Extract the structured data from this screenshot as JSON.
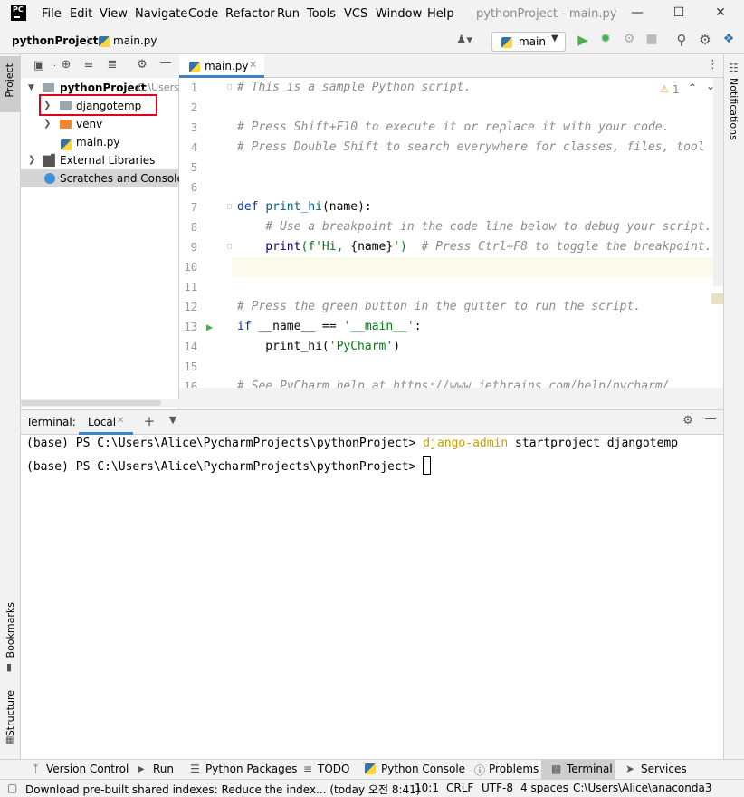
{
  "titlebar": {
    "logo": "PC",
    "menu": [
      "File",
      "Edit",
      "View",
      "Navigate",
      "Code",
      "Refactor",
      "Run",
      "Tools",
      "VCS",
      "Window",
      "Help"
    ],
    "window_title": "pythonProject - main.py"
  },
  "navbar": {
    "project": "pythonProject",
    "file": "main.py",
    "run_config": "main"
  },
  "left_stripe": {
    "project": "Project",
    "bookmarks": "Bookmarks",
    "structure": "Structure"
  },
  "right_stripe": {
    "notifications": "Notifications"
  },
  "project_tree": {
    "root": "pythonProject",
    "root_path": "C:\\Users",
    "items": [
      "djangotemp",
      "venv",
      "main.py"
    ],
    "external": "External Libraries",
    "scratches": "Scratches and Consoles"
  },
  "editor": {
    "tab": "main.py",
    "warning_count": "1",
    "line_numbers": [
      "1",
      "2",
      "3",
      "4",
      "5",
      "6",
      "7",
      "8",
      "9",
      "10",
      "11",
      "12",
      "13",
      "14",
      "15",
      "16"
    ],
    "comment1": "# This is a sample Python script.",
    "comment2": "# Press Shift+F10 to execute it or replace it with your code.",
    "comment3": "# Press Double Shift to search everywhere for classes, files, tool",
    "def_kw": "def",
    "def_name": "print_hi",
    "def_rest": "(name):",
    "comment4": "    # Use a breakpoint in the code line below to debug your script.",
    "print_call": "    print",
    "print_str_a": "(f'Hi, ",
    "print_name": "{name}",
    "print_str_b": "')",
    "comment5": "  # Press Ctrl+F8 to toggle the breakpoint.",
    "comment6": "# Press the green button in the gutter to run the script.",
    "if_kw": "if",
    "if_rest": " __name__ == ",
    "if_str": "'__main__'",
    "if_colon": ":",
    "call_name": "    print_hi(",
    "call_str": "'PyCharm'",
    "call_close": ")",
    "comment7": "# See PyCharm help at https://www.jetbrains.com/help/pycharm/"
  },
  "terminal": {
    "label": "Terminal:",
    "tab": "Local",
    "prompt": "(base) PS C:\\Users\\Alice\\PycharmProjects\\pythonProject>",
    "command_highlight": "django-admin",
    "command_rest": " startproject djangotemp"
  },
  "bottom_tools": [
    "Version Control",
    "Run",
    "Python Packages",
    "TODO",
    "Python Console",
    "Problems",
    "Terminal",
    "Services"
  ],
  "status": {
    "message": "Download pre-built shared indexes: Reduce the index... (today 오전 8:41)",
    "position": "10:1",
    "line_sep": "CRLF",
    "encoding": "UTF-8",
    "indent": "4 spaces",
    "interpreter": "C:\\Users\\Alice\\anaconda3"
  },
  "colors": {
    "accent": "#4083c9",
    "highlight_box": "#e0001b",
    "run_green": "#4caf50",
    "terminal_cmd": "#c8a000"
  }
}
